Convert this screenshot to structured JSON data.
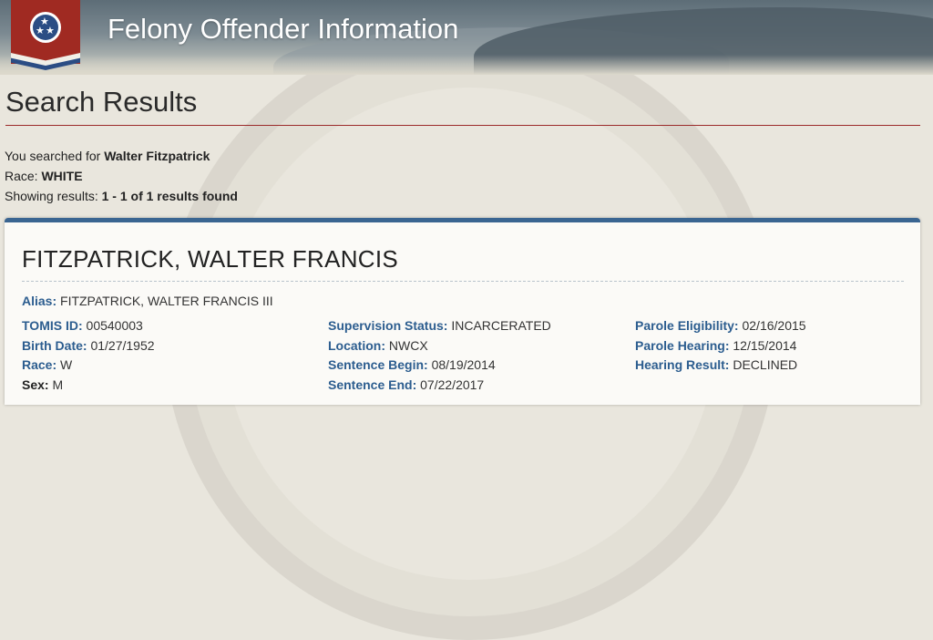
{
  "header": {
    "site_title": "Felony Offender Information"
  },
  "page": {
    "title": "Search Results"
  },
  "search": {
    "searched_prefix": "You searched for",
    "searched_name": "Walter Fitzpatrick",
    "race_label": "Race:",
    "race_value": "WHITE",
    "showing_label": "Showing results:",
    "showing_value": "1 - 1 of 1 results found"
  },
  "result": {
    "name": "FITZPATRICK, WALTER FRANCIS",
    "alias_label": "Alias:",
    "alias_value": "FITZPATRICK, WALTER FRANCIS III",
    "col1": [
      {
        "label": "TOMIS ID:",
        "value": "00540003"
      },
      {
        "label": "Birth Date:",
        "value": "01/27/1952"
      },
      {
        "label": "Race:",
        "value": "W"
      },
      {
        "label": "Sex:",
        "value": "M"
      }
    ],
    "col2": [
      {
        "label": "Supervision Status:",
        "value": "INCARCERATED"
      },
      {
        "label": "Location:",
        "value": "NWCX"
      },
      {
        "label": "Sentence Begin:",
        "value": "08/19/2014"
      },
      {
        "label": "Sentence End:",
        "value": "07/22/2017"
      }
    ],
    "col3": [
      {
        "label": "Parole Eligibility:",
        "value": "02/16/2015"
      },
      {
        "label": "Parole Hearing:",
        "value": "12/15/2014"
      },
      {
        "label": "Hearing Result:",
        "value": "DECLINED"
      }
    ]
  },
  "colors": {
    "header_bg": "#6f7e87",
    "flag_red": "#a02a22",
    "flag_blue": "#2b4d84",
    "label_blue": "#2c5d8f",
    "card_border": "#3a6591",
    "title_rule": "#9b2a2a"
  },
  "icons": {
    "logo": "tennessee-tristar-icon"
  }
}
